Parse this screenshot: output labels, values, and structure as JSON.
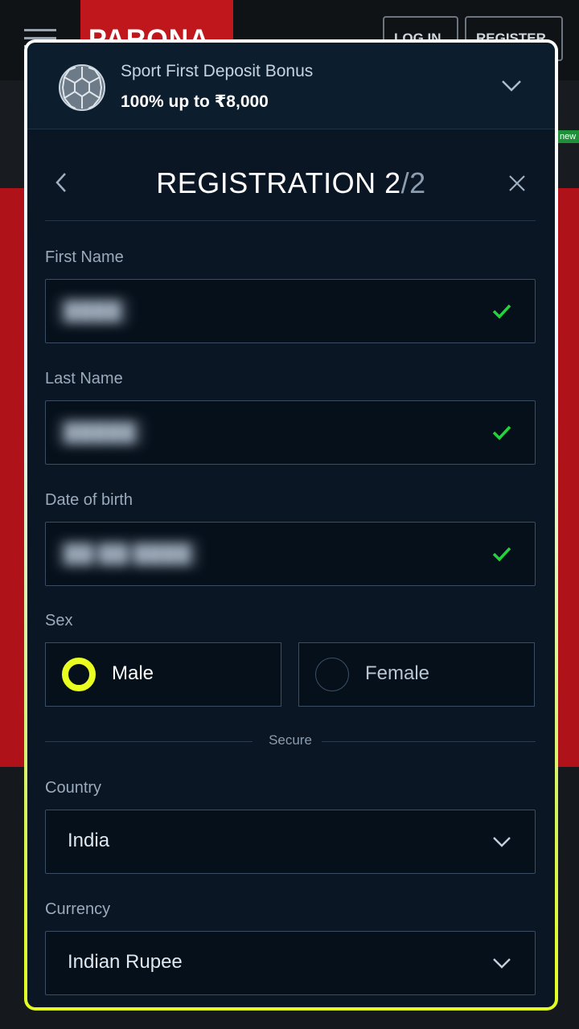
{
  "background": {
    "logo": "PARONA",
    "login_label": "LOG IN",
    "register_label": "REGISTER",
    "new_badge": "new"
  },
  "bonus": {
    "title": "Sport First Deposit Bonus",
    "amount": "100% up to ₹8,000",
    "icon": "soccer-ball-icon"
  },
  "registration": {
    "title": "REGISTRATION 2",
    "step_total": "/2"
  },
  "form": {
    "first_name": {
      "label": "First Name",
      "value": "████",
      "valid": true
    },
    "last_name": {
      "label": "Last Name",
      "value": "█████",
      "valid": true
    },
    "dob": {
      "label": "Date of birth",
      "value": "██/██/████",
      "valid": true
    },
    "sex": {
      "label": "Sex",
      "options": [
        {
          "label": "Male",
          "selected": true
        },
        {
          "label": "Female",
          "selected": false
        }
      ]
    },
    "secure_label": "Secure",
    "country": {
      "label": "Country",
      "value": "India"
    },
    "currency": {
      "label": "Currency",
      "value": "Indian Rupee"
    }
  },
  "colors": {
    "accent": "#e9ff1f",
    "valid_check": "#22d33a",
    "modal_bg": "#0a1623",
    "field_border": "#3a4d62"
  }
}
